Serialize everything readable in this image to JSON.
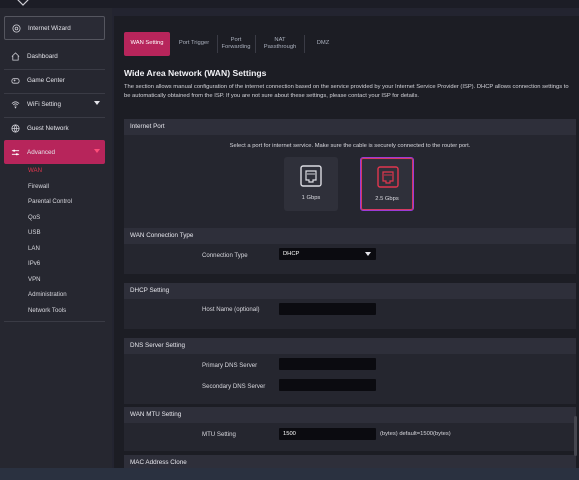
{
  "sidebar": {
    "wizard_label": "Internet Wizard",
    "items": [
      {
        "label": "Dashboard"
      },
      {
        "label": "Game Center"
      },
      {
        "label": "WiFi Setting"
      },
      {
        "label": "Guest Network"
      },
      {
        "label": "Advanced"
      }
    ],
    "subitems": [
      "WAN",
      "Firewall",
      "Parental Control",
      "QoS",
      "USB",
      "LAN",
      "IPv6",
      "VPN",
      "Administration",
      "Network Tools"
    ],
    "active_subitem": "WAN"
  },
  "tabs": [
    {
      "label": "WAN Setting",
      "active": true
    },
    {
      "label": "Port Trigger"
    },
    {
      "label": "Port Forwarding"
    },
    {
      "label": "NAT Passthrough"
    },
    {
      "label": "DMZ"
    }
  ],
  "page": {
    "title": "Wide Area Network (WAN) Settings",
    "description": "The section allows manual configuration of the internet connection based on the service provided by your Internet Service Provider (ISP). DHCP allows connection settings to be automatically obtained from the ISP. If you are not sure about these settings, please contact your ISP for details."
  },
  "internet_port": {
    "header": "Internet Port",
    "instruction": "Select a port for internet service. Make sure the cable is securely connected to the router port.",
    "options": [
      {
        "label": "1 Gbps",
        "selected": false
      },
      {
        "label": "2.5 Gbps",
        "selected": true
      }
    ]
  },
  "wan_connection": {
    "header": "WAN Connection Type",
    "label": "Connection Type",
    "value": "DHCP"
  },
  "dhcp": {
    "header": "DHCP Setting",
    "host_label": "Host Name (optional)",
    "host_value": ""
  },
  "dns": {
    "header": "DNS Server Setting",
    "primary_label": "Primary DNS Server",
    "primary_value": "",
    "secondary_label": "Secondary DNS Server",
    "secondary_value": ""
  },
  "mtu": {
    "header": "WAN MTU Setting",
    "label": "MTU Setting",
    "value": "1500",
    "hint": "(bytes) default=1500(bytes)"
  },
  "mac": {
    "header": "MAC Address Clone"
  },
  "colors": {
    "accent": "#b7255b",
    "active_text": "#e0364e",
    "selected_border": "#9a3bd6"
  }
}
